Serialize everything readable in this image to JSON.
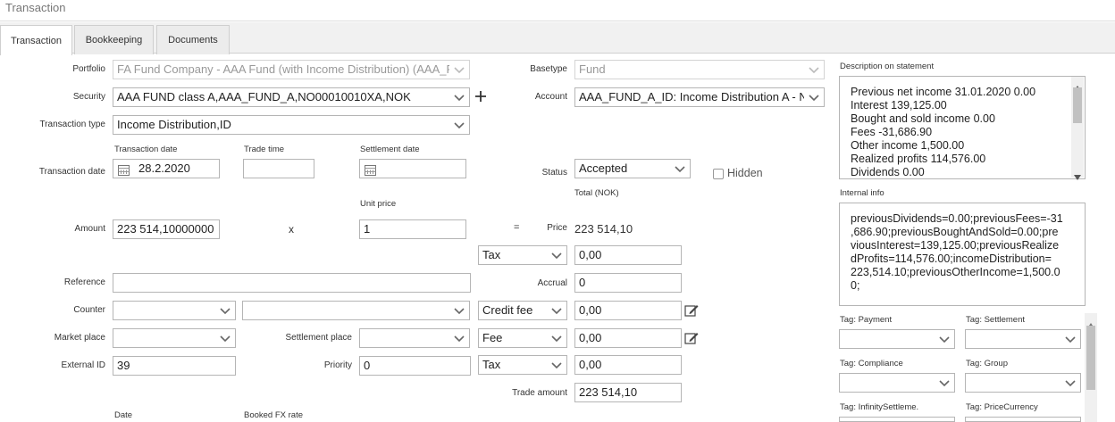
{
  "window": {
    "title": "Transaction"
  },
  "tabs": [
    {
      "label": "Transaction",
      "active": true
    },
    {
      "label": "Bookkeeping",
      "active": false
    },
    {
      "label": "Documents",
      "active": false
    }
  ],
  "form": {
    "portfolio": {
      "label": "Portfolio",
      "value": "FA Fund Company - AAA Fund (with Income Distribution) (AAA_F"
    },
    "security": {
      "label": "Security",
      "value": "AAA FUND class A,AAA_FUND_A,NO00010010XA,NOK",
      "add_icon": "plus-icon"
    },
    "transaction_type": {
      "label": "Transaction type",
      "value": "Income Distribution,ID"
    },
    "transaction_date_row": {
      "label": "Transaction date",
      "transaction_date": {
        "caption": "Transaction date",
        "value": "28.2.2020"
      },
      "trade_time": {
        "caption": "Trade time",
        "value": ""
      },
      "settlement_date": {
        "caption": "Settlement date",
        "value": ""
      }
    },
    "amount": {
      "label": "Amount",
      "value": "223 514,10000000"
    },
    "multiply": "x",
    "unit_price": {
      "caption": "Unit price",
      "value": "1"
    },
    "equals": "=",
    "reference": {
      "label": "Reference",
      "value": ""
    },
    "counter": {
      "label": "Counter",
      "value1": "",
      "value2": ""
    },
    "market_place": {
      "label": "Market place",
      "value": ""
    },
    "settlement_place": {
      "label": "Settlement place",
      "value": ""
    },
    "external_id": {
      "label": "External ID",
      "value": "39"
    },
    "priority": {
      "label": "Priority",
      "value": "0"
    },
    "date_caption": "Date",
    "booked_fx_caption": "Booked FX rate",
    "basetype": {
      "label": "Basetype",
      "value": "Fund"
    },
    "account": {
      "label": "Account",
      "value": "AAA_FUND_A_ID: Income Distribution A - NOK"
    },
    "status": {
      "label": "Status",
      "value": "Accepted"
    },
    "hidden": {
      "label": "Hidden",
      "checked": false
    },
    "total_caption": "Total (NOK)",
    "price": {
      "label": "Price",
      "value": "223 514,10"
    },
    "tax1": {
      "type": "Tax",
      "value": "0,00"
    },
    "accrual": {
      "label": "Accrual",
      "value": "0"
    },
    "credit_fee": {
      "type": "Credit fee",
      "value": "0,00"
    },
    "fee": {
      "type": "Fee",
      "value": "0,00"
    },
    "tax2": {
      "type": "Tax",
      "value": "0,00"
    },
    "trade_amount": {
      "label": "Trade amount",
      "value": "223 514,10"
    }
  },
  "right": {
    "description": {
      "label": "Description on statement",
      "lines": [
        "Previous net income 31.01.2020 0.00",
        "Interest 139,125.00",
        "Bought and sold income 0.00",
        "Fees -31,686.90",
        "Other income 1,500.00",
        "Realized profits 114,576.00",
        "Dividends 0.00"
      ]
    },
    "internal_info": {
      "label": "Internal info",
      "lines": [
        "previousDividends=0.00;previousFees=-31",
        ",686.90;previousBoughtAndSold=0.00;pre",
        "viousInterest=139,125.00;previousRealize",
        "dProfits=114,576.00;incomeDistribution=",
        "223,514.10;previousOtherIncome=1,500.0",
        "0;"
      ]
    },
    "tags": [
      {
        "label": "Tag: Payment",
        "value": ""
      },
      {
        "label": "Tag: Settlement",
        "value": ""
      },
      {
        "label": "Tag: Compliance",
        "value": ""
      },
      {
        "label": "Tag: Group",
        "value": ""
      },
      {
        "label": "Tag: InfinitySettleme.",
        "value": ""
      },
      {
        "label": "Tag: PriceCurrency",
        "value": ""
      }
    ]
  }
}
